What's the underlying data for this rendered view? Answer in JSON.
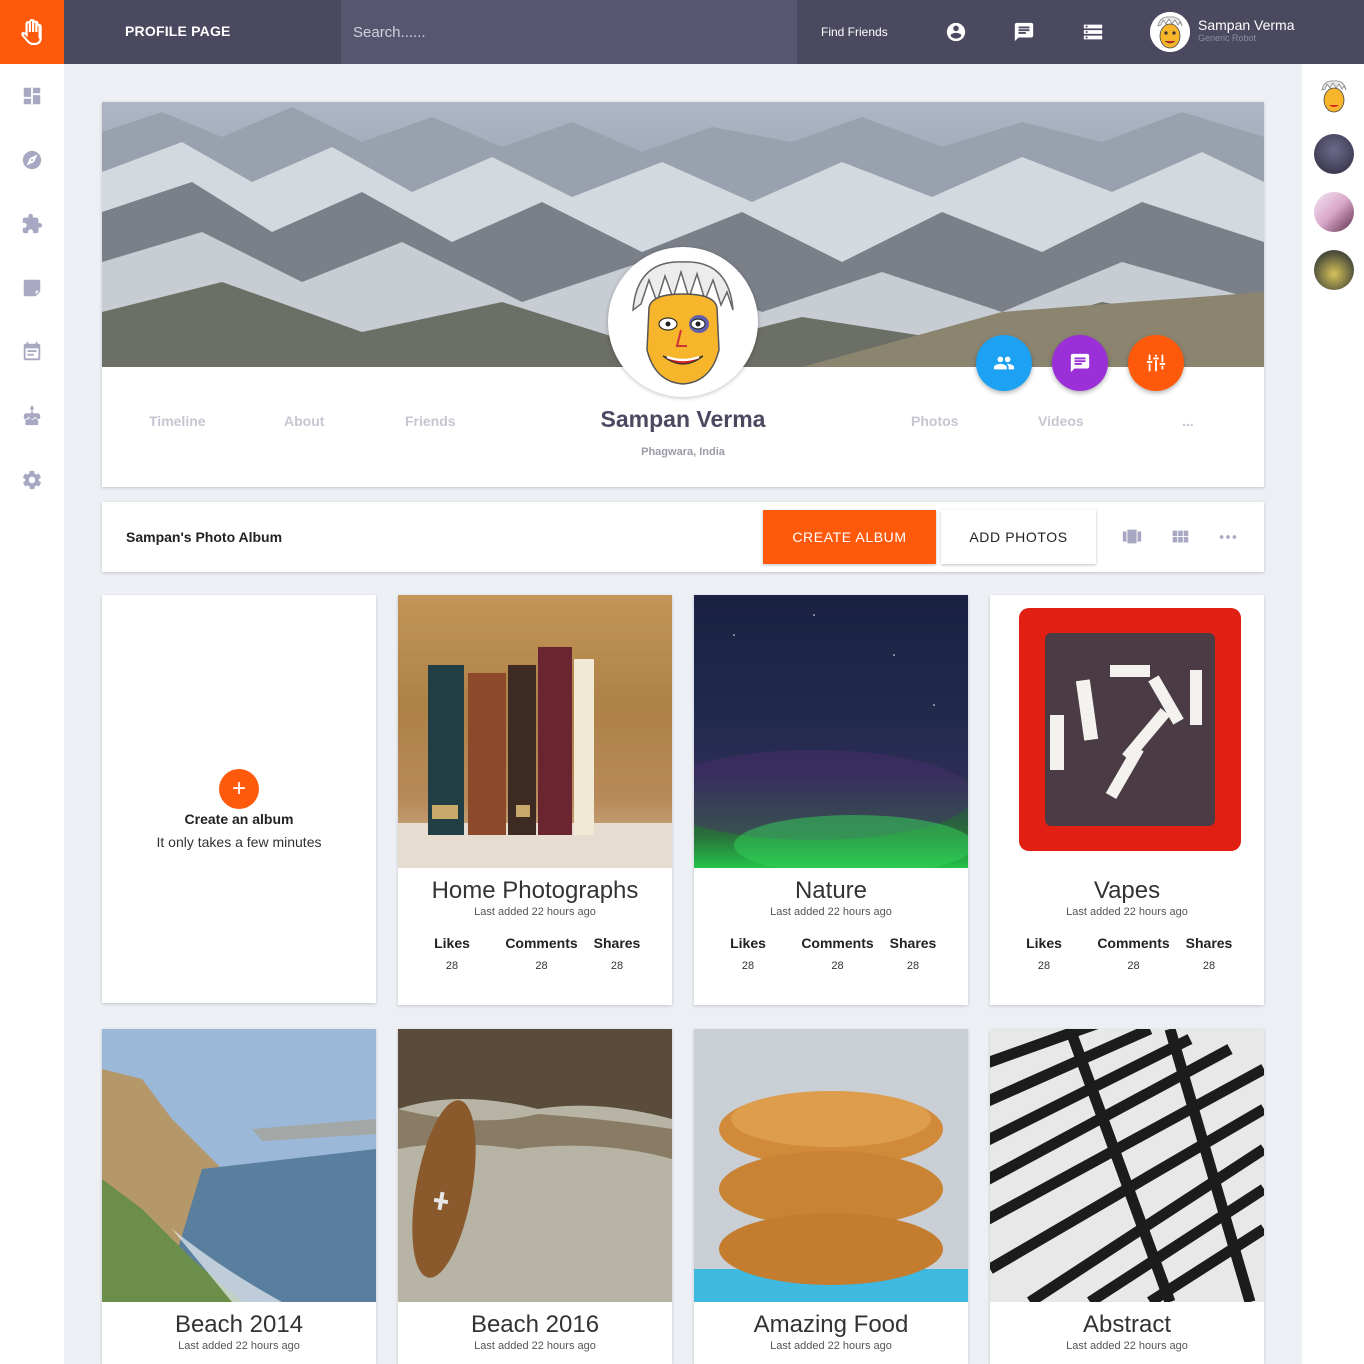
{
  "header": {
    "title": "PROFILE PAGE",
    "search_placeholder": "Search......",
    "find_friends": "Find Friends",
    "user_name": "Sampan Verma",
    "user_subtitle": "Generic Robot",
    "accent": "#ff5a0b"
  },
  "sidebar": {
    "items": [
      {
        "icon": "dashboard-icon"
      },
      {
        "icon": "compass-icon"
      },
      {
        "icon": "puzzle-icon"
      },
      {
        "icon": "label-icon"
      },
      {
        "icon": "calendar-icon"
      },
      {
        "icon": "cake-icon"
      },
      {
        "icon": "settings-icon"
      }
    ]
  },
  "profile": {
    "name": "Sampan Verma",
    "location": "Phagwara, India",
    "tabs": [
      "Timeline",
      "About",
      "Friends",
      "Photos",
      "Videos",
      "..."
    ],
    "fab_colors": [
      "#1da1f2",
      "#9b30d9",
      "#ff5a0b"
    ]
  },
  "album_bar": {
    "title": "Sampan's Photo Album",
    "create_label": "CREATE ALBUM",
    "add_label": "ADD PHOTOS"
  },
  "create_card": {
    "title": "Create an album",
    "subtitle": "It only takes a few minutes"
  },
  "albums": [
    {
      "title": "Home Photographs",
      "subtitle": "Last added 22 hours ago",
      "likes_label": "Likes",
      "comments_label": "Comments",
      "shares_label": "Shares",
      "likes": "28",
      "comments": "28",
      "shares": "28"
    },
    {
      "title": "Nature",
      "subtitle": "Last added 22 hours ago",
      "likes_label": "Likes",
      "comments_label": "Comments",
      "shares_label": "Shares",
      "likes": "28",
      "comments": "28",
      "shares": "28"
    },
    {
      "title": "Vapes",
      "subtitle": "Last added 22 hours ago",
      "likes_label": "Likes",
      "comments_label": "Comments",
      "shares_label": "Shares",
      "likes": "28",
      "comments": "28",
      "shares": "28"
    },
    {
      "title": "Beach 2014",
      "subtitle": "Last added 22 hours ago"
    },
    {
      "title": "Beach 2016",
      "subtitle": "Last added 22 hours ago"
    },
    {
      "title": "Amazing Food",
      "subtitle": "Last added 22 hours ago"
    },
    {
      "title": "Abstract",
      "subtitle": "Last added 22 hours ago"
    }
  ]
}
